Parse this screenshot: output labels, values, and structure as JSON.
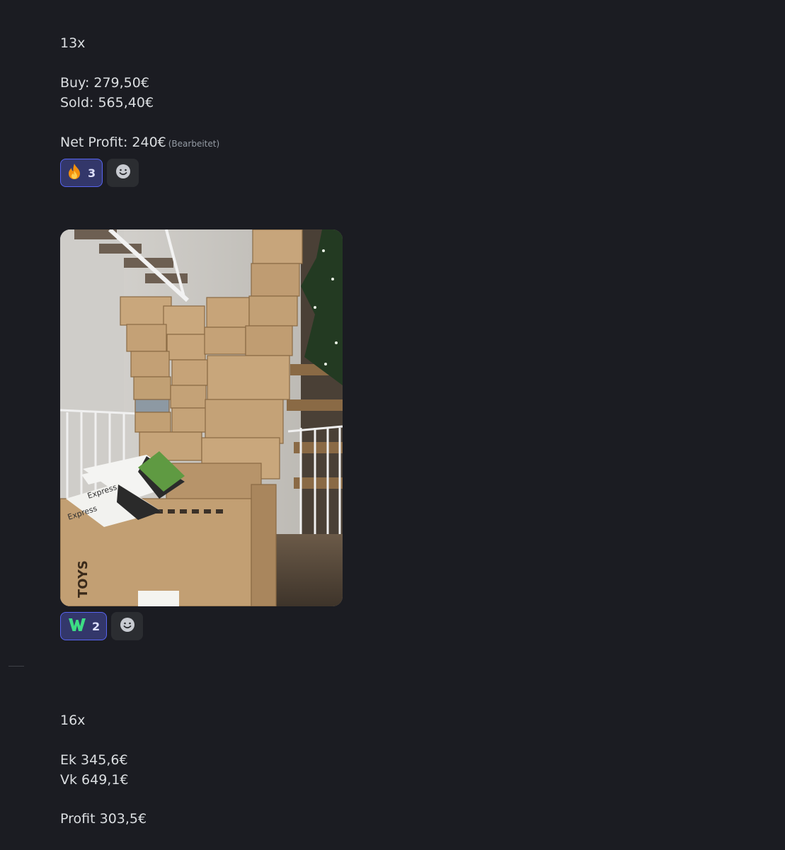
{
  "messages": [
    {
      "lines": [
        "13x",
        "Buy: 279,50€",
        "Sold: 565,40€",
        "Net Profit: 240€"
      ],
      "edited_label": "(Bearbeitet)",
      "reactions": [
        {
          "emoji": "fire",
          "count": "3"
        }
      ]
    },
    {
      "attachment": "photo-of-stacked-cardboard-boxes",
      "image_text": [
        "TOYS",
        "Express",
        "Express"
      ],
      "reactions": [
        {
          "emoji": "W",
          "count": "2"
        }
      ]
    },
    {
      "lines": [
        "16x",
        "Ek 345,6€",
        "Vk 649,1€",
        "Profit 303,5€"
      ]
    }
  ],
  "colors": {
    "background": "#1b1c22",
    "text": "#dbdee1",
    "reaction_bg": "#33376a",
    "reaction_border": "#5865f2",
    "add_reaction_bg": "#2b2d31",
    "w_emoji": "#3ddc84"
  }
}
